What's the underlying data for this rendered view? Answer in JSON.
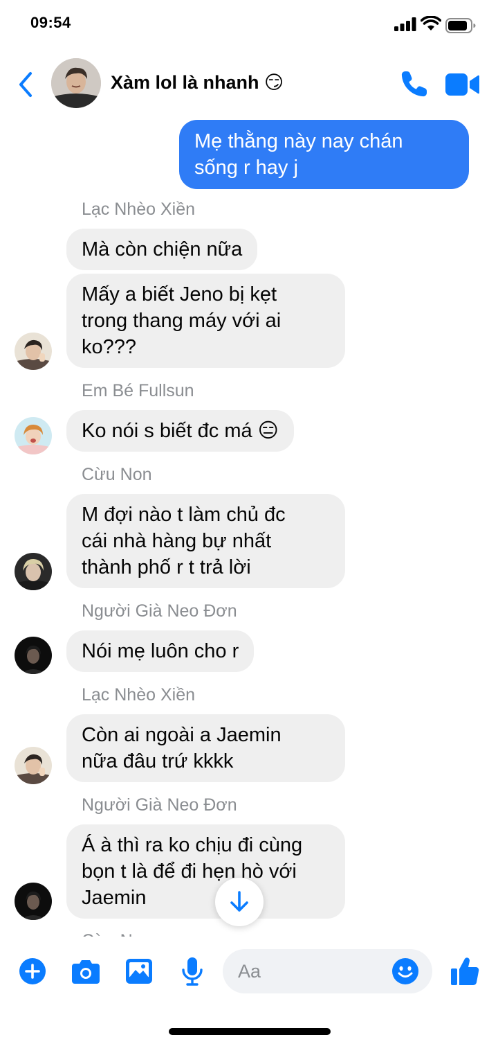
{
  "status_bar": {
    "time": "09:54"
  },
  "header": {
    "title": "Xàm lol là nhanh 😏"
  },
  "messages": [
    {
      "type": "outgoing",
      "lines": [
        "Mẹ thằng này nay chán",
        "sống r hay j"
      ]
    },
    {
      "type": "name",
      "text": "Lạc Nhèo Xiền"
    },
    {
      "type": "incoming",
      "lines": [
        "Mà còn chiện nữa"
      ]
    },
    {
      "type": "incoming",
      "lines": [
        "Mấy a biết Jeno bị kẹt",
        "trong thang máy với ai",
        "ko???"
      ]
    },
    {
      "type": "name",
      "text": "Em Bé Fullsun"
    },
    {
      "type": "incoming",
      "lines": [
        "Ko nói s biết đc má 😑"
      ]
    },
    {
      "type": "name",
      "text": "Cừu Non"
    },
    {
      "type": "incoming",
      "lines": [
        "M đợi nào t làm chủ đc",
        "cái nhà hàng bự nhất",
        "thành phố r t trả lời"
      ]
    },
    {
      "type": "name",
      "text": "Người Già Neo Đơn"
    },
    {
      "type": "incoming",
      "lines": [
        "Nói mẹ luôn cho r"
      ]
    },
    {
      "type": "name",
      "text": "Lạc Nhèo Xiền"
    },
    {
      "type": "incoming",
      "lines": [
        "Còn ai ngoài a Jaemin",
        "nữa đâu trứ kkkk"
      ]
    },
    {
      "type": "name",
      "text": "Người Già Neo Đơn"
    },
    {
      "type": "incoming",
      "lines": [
        "Á à thì ra ko chịu đi cùng",
        "bọn t là để đi hẹn hò với",
        "Jaemin"
      ]
    },
    {
      "type": "name",
      "text": "Cừu Non"
    }
  ],
  "composer": {
    "placeholder": "Aa"
  },
  "icons": {
    "back": "chevron-left-icon",
    "call": "phone-icon",
    "video": "video-camera-icon",
    "scroll_down": "arrow-down-icon",
    "add": "plus-circle-icon",
    "camera": "camera-icon",
    "gallery": "image-icon",
    "mic": "microphone-icon",
    "emoji": "smiley-icon",
    "like": "thumbs-up-icon"
  },
  "colors": {
    "accent": "#0a7cff",
    "outgoing_bubble": "#2f7cf6",
    "incoming_bubble": "#efefef",
    "name_text": "#8a8d91"
  }
}
